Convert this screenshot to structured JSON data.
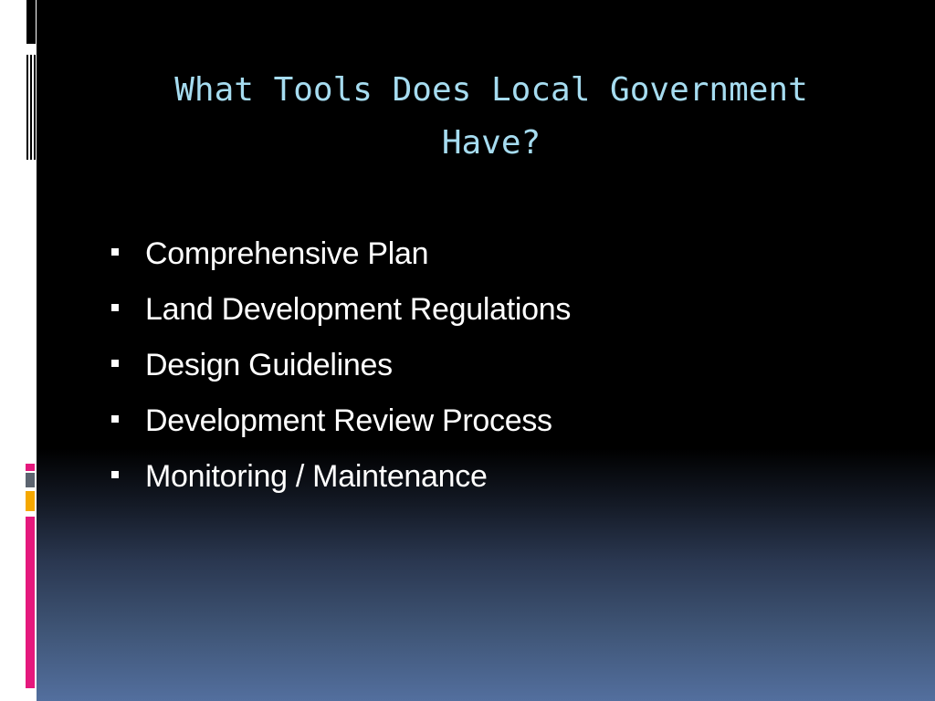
{
  "slide": {
    "title": "What Tools Does Local Government\nHave?",
    "bullets": [
      "Comprehensive Plan",
      "Land Development Regulations",
      "Design Guidelines",
      "Development Review Process",
      "Monitoring / Maintenance"
    ]
  },
  "colors": {
    "title": "#a6dcf0",
    "bullet_text": "#ffffff",
    "background_top": "#000000",
    "background_bottom": "#536f9e",
    "accent_magenta": "#e5187d",
    "accent_orange": "#f5a800",
    "accent_gray": "#5c6470"
  }
}
